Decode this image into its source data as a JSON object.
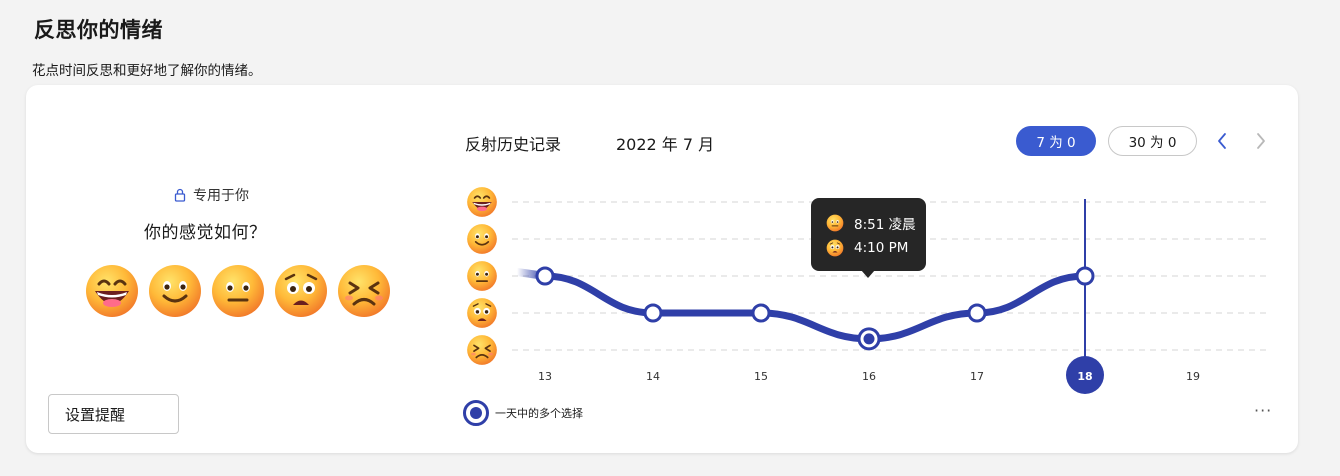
{
  "header": {
    "title": "反思你的情绪",
    "subtitle": "花点时间反思和更好地了解你的情绪。"
  },
  "checkin": {
    "private_label": "专用于你",
    "question": "你的感觉如何？",
    "moods": [
      "grinning",
      "smiling",
      "neutral",
      "worried",
      "distressed"
    ],
    "reminder_button": "设置提醒"
  },
  "history": {
    "label": "反射历史记录",
    "month": "2022 年 7 月",
    "range_options": [
      "7 为 0",
      "30 为 0"
    ],
    "selected_range": "7 为 0",
    "x_labels": [
      "13",
      "14",
      "15",
      "16",
      "17",
      "18",
      "19"
    ],
    "selected_day": "18",
    "legend_label": "一天中的多个选择",
    "more_label": "···",
    "tooltip": [
      {
        "mood": "neutral",
        "time": "8:51 凌晨"
      },
      {
        "mood": "worried",
        "time": "4:10 PM"
      }
    ]
  },
  "chart_data": {
    "type": "line",
    "x": [
      13,
      14,
      15,
      16,
      17,
      18
    ],
    "y_scale_from_top": [
      "grinning",
      "smiling",
      "neutral",
      "worried",
      "distressed"
    ],
    "values": [
      2,
      3,
      3,
      3.7,
      3,
      2
    ],
    "note_multi": [
      false,
      false,
      false,
      true,
      false,
      false
    ]
  },
  "colors": {
    "accent": "#3a5bd0",
    "line": "#2f3fa8",
    "tooltip_bg": "#262626"
  }
}
